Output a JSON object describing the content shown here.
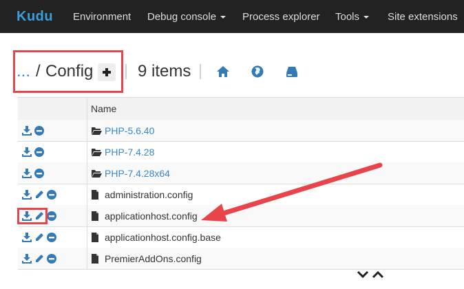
{
  "navbar": {
    "brand": "Kudu",
    "items": [
      {
        "label": "Environment"
      },
      {
        "label": "Debug console"
      },
      {
        "label": "Process explorer"
      },
      {
        "label": "Tools"
      },
      {
        "label": "Site extensions"
      }
    ]
  },
  "breadcrumb": {
    "ellipsis": "...",
    "separator": "/",
    "current": "Config",
    "items_count": "9 items"
  },
  "table": {
    "headers": [
      "",
      "Name"
    ],
    "rows": [
      {
        "name": "PHP-5.6.40",
        "type": "folder",
        "actions": [
          "download-icon",
          "delete-icon"
        ]
      },
      {
        "name": "PHP-7.4.28",
        "type": "folder",
        "actions": [
          "download-icon",
          "delete-icon"
        ]
      },
      {
        "name": "PHP-7.4.28x64",
        "type": "folder",
        "actions": [
          "download-icon",
          "delete-icon"
        ]
      },
      {
        "name": "administration.config",
        "type": "file",
        "actions": [
          "download-icon",
          "edit-icon",
          "delete-icon"
        ]
      },
      {
        "name": "applicationhost.config",
        "type": "file",
        "actions": [
          "download-icon",
          "edit-icon",
          "delete-icon"
        ]
      },
      {
        "name": "applicationhost.config.base",
        "type": "file",
        "actions": [
          "download-icon",
          "edit-icon",
          "delete-icon"
        ]
      },
      {
        "name": "PremierAddOns.config",
        "type": "file",
        "actions": [
          "download-icon",
          "edit-icon",
          "delete-icon"
        ]
      }
    ]
  },
  "colors": {
    "navbar_bg": "#222222",
    "link": "#3a87c8",
    "icon_blue": "#337ab7",
    "annotation_red": "#e8454b"
  }
}
